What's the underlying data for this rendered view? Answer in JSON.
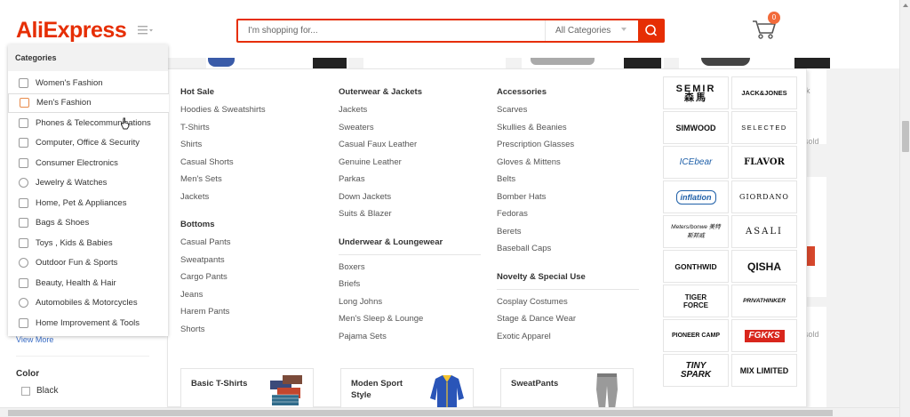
{
  "header": {
    "logo": "AliExpress",
    "search_placeholder": "I'm shopping for...",
    "search_category": "All Categories",
    "cart_count": "0",
    "accent_color": "#e62e04"
  },
  "categories": {
    "title": "Categories",
    "items": [
      {
        "label": "Women's Fashion",
        "icon": "dress-icon"
      },
      {
        "label": "Men's Fashion",
        "icon": "shirt-icon"
      },
      {
        "label": "Phones & Telecommunications",
        "icon": "phone-icon"
      },
      {
        "label": "Computer, Office & Security",
        "icon": "laptop-icon"
      },
      {
        "label": "Consumer Electronics",
        "icon": "camera-icon"
      },
      {
        "label": "Jewelry & Watches",
        "icon": "ring-icon"
      },
      {
        "label": "Home, Pet & Appliances",
        "icon": "house-icon"
      },
      {
        "label": "Bags & Shoes",
        "icon": "bag-icon"
      },
      {
        "label": "Toys , Kids & Babies",
        "icon": "toy-icon"
      },
      {
        "label": "Outdoor Fun & Sports",
        "icon": "ball-icon"
      },
      {
        "label": "Beauty, Health & Hair",
        "icon": "lipstick-icon"
      },
      {
        "label": "Automobiles & Motorcycles",
        "icon": "wheel-icon"
      },
      {
        "label": "Home Improvement & Tools",
        "icon": "tools-icon"
      }
    ],
    "active_index": 1
  },
  "sidebar": {
    "view_more": "View More",
    "color_title": "Color",
    "color_option": "Black"
  },
  "mega_menu": {
    "col1": {
      "groups": [
        {
          "title": "Hot Sale",
          "links": [
            "Hoodies & Sweatshirts",
            "T-Shirts",
            "Shirts",
            "Casual Shorts",
            "Men's Sets",
            "Jackets"
          ]
        },
        {
          "title": "Bottoms",
          "links": [
            "Casual Pants",
            "Sweatpants",
            "Cargo Pants",
            "Jeans",
            "Harem Pants",
            "Shorts"
          ]
        }
      ]
    },
    "col2": {
      "groups": [
        {
          "title": "Outerwear & Jackets",
          "links": [
            "Jackets",
            "Sweaters",
            "Casual Faux Leather",
            "Genuine Leather",
            "Parkas",
            "Down Jackets",
            "Suits & Blazer"
          ]
        },
        {
          "title": "Underwear & Loungewear",
          "links": [
            "Boxers",
            "Briefs",
            "Long Johns",
            "Men's Sleep & Lounge",
            "Pajama Sets"
          ]
        }
      ]
    },
    "col3": {
      "groups": [
        {
          "title": "Accessories",
          "links": [
            "Scarves",
            "Skullies & Beanies",
            "Prescription Glasses",
            "Gloves & Mittens",
            "Belts",
            "Bomber Hats",
            "Fedoras",
            "Berets",
            "Baseball Caps"
          ]
        },
        {
          "title": "Novelty & Special Use",
          "links": [
            "Cosplay Costumes",
            "Stage & Dance Wear",
            "Exotic Apparel"
          ]
        }
      ]
    },
    "promos": [
      "Basic T-Shirts",
      "Moden Sport Style",
      "SweatPants"
    ],
    "brands": [
      "SEMIR 森馬",
      "JACK&JONES",
      "SIMWOOD",
      "SELECTED",
      "ICEbear",
      "FLAVOR",
      "inflation",
      "GIORDANO",
      "Meters/bonwe 美特斯邦威",
      "ASALI",
      "GONTHWID",
      "QISHA",
      "TIGER FORCE",
      "PRIVATHINKER",
      "PIONEER CAMP",
      "FGKKS",
      "TINY SPARK",
      "MIX LIMITED"
    ]
  },
  "background": {
    "sold_label_1": "sold",
    "sold_label_2": "sold",
    "partial_text": "ik"
  }
}
